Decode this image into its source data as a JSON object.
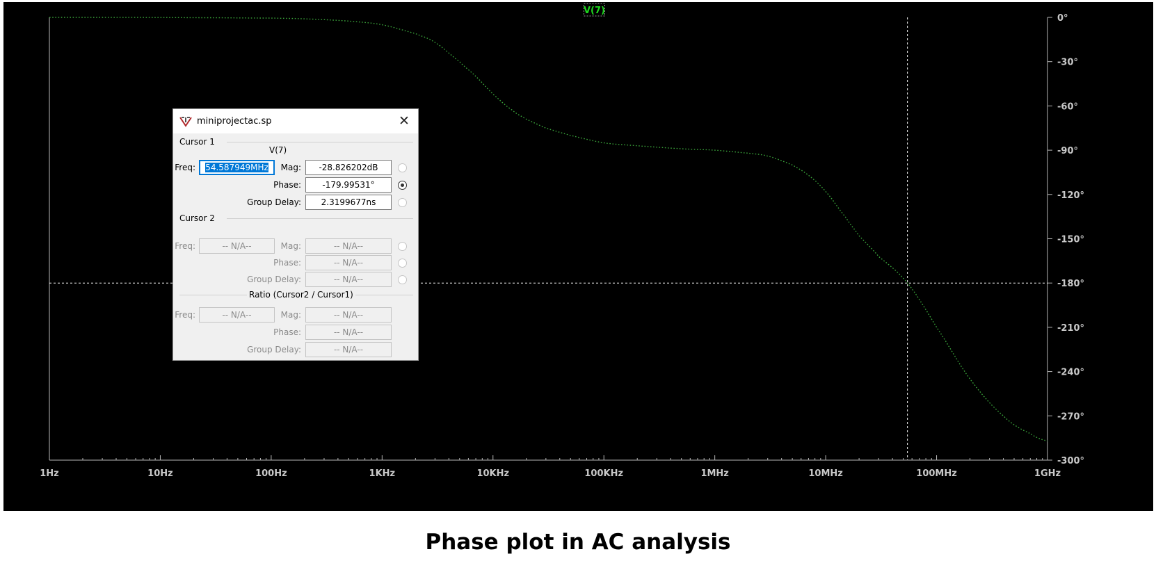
{
  "plot": {
    "trace_label": "V(7)",
    "colors": {
      "background": "#000000",
      "trace": "#3aa33a",
      "axis": "#b8b8b8",
      "label": "#c9c9c9",
      "cursor": "#ffffff",
      "trace_label": "#1fd91f"
    },
    "cursor": {
      "freq_hz": 54587949,
      "phase_deg": -180
    }
  },
  "chart_data": {
    "type": "line",
    "title": "",
    "xscale": "log",
    "xlim_hz": [
      1,
      1000000000
    ],
    "ylim_deg": [
      -300,
      0
    ],
    "x_tick_labels": [
      "1Hz",
      "10Hz",
      "100Hz",
      "1KHz",
      "10KHz",
      "100KHz",
      "1MHz",
      "10MHz",
      "100MHz",
      "1GHz"
    ],
    "y_tick_labels": [
      "0°",
      "-30°",
      "-60°",
      "-90°",
      "-120°",
      "-150°",
      "-180°",
      "-210°",
      "-240°",
      "-270°",
      "-300°"
    ],
    "series": [
      {
        "name": "V(7)",
        "x_hz": [
          1,
          10,
          100,
          200,
          500,
          1000,
          2000,
          3000,
          5000,
          7000,
          10000,
          15000,
          20000,
          30000,
          50000,
          100000,
          200000,
          500000,
          1000000,
          2000000,
          3000000,
          5000000,
          7000000,
          10000000,
          15000000,
          20000000,
          30000000,
          54587949,
          100000000,
          200000000,
          400000000,
          700000000,
          1000000000
        ],
        "phase_deg": [
          0,
          -0.1,
          -0.5,
          -1,
          -2.5,
          -5,
          -11,
          -17,
          -30,
          -40,
          -52,
          -63,
          -69,
          -75,
          -80,
          -85,
          -87,
          -89,
          -90,
          -92,
          -94,
          -100,
          -107,
          -118,
          -135,
          -148,
          -162,
          -180,
          -210,
          -245,
          -270,
          -282,
          -287
        ]
      }
    ]
  },
  "dialog": {
    "title": "miniprojectac.sp",
    "app_icon": "ltspice-app-icon",
    "close_glyph": "✕",
    "cursor1": {
      "section": "Cursor 1",
      "trace": "V(7)",
      "freq_label": "Freq:",
      "freq": "54.587949MHz",
      "mag_label": "Mag:",
      "mag": "-28.826202dB",
      "phase_label": "Phase:",
      "phase": "-179.99531°",
      "gd_label": "Group Delay:",
      "gd": "2.3199677ns",
      "selected_readout": "phase"
    },
    "cursor2": {
      "section": "Cursor 2",
      "freq_label": "Freq:",
      "freq": "-- N/A--",
      "mag_label": "Mag:",
      "mag": "-- N/A--",
      "phase_label": "Phase:",
      "phase": "-- N/A--",
      "gd_label": "Group Delay:",
      "gd": "-- N/A--"
    },
    "ratio": {
      "section": "Ratio (Cursor2 / Cursor1)",
      "freq_label": "Freq:",
      "freq": "-- N/A--",
      "mag_label": "Mag:",
      "mag": "-- N/A--",
      "phase_label": "Phase:",
      "phase": "-- N/A--",
      "gd_label": "Group Delay:",
      "gd": "-- N/A--"
    }
  },
  "caption": "Phase plot in AC analysis"
}
